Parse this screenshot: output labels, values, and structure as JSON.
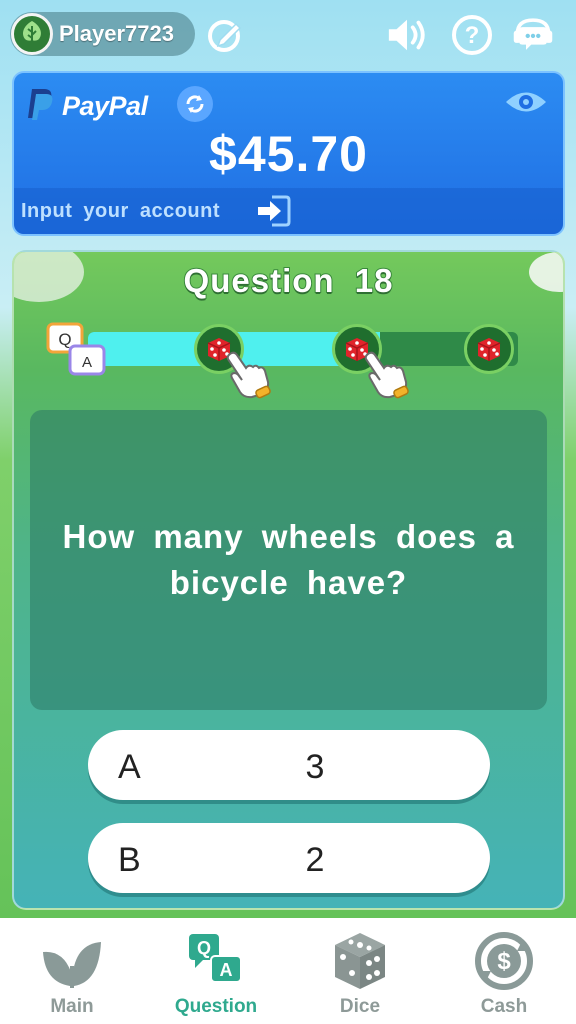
{
  "header": {
    "player_name": "Player7723",
    "icons": [
      "tree-avatar-icon",
      "edit-icon",
      "sound-icon",
      "help-icon",
      "support-chat-icon"
    ]
  },
  "paypal": {
    "brand": "PayPal",
    "balance": "$45.70",
    "account_prompt": "Input your account",
    "icons": [
      "paypal-icon",
      "refresh-icon",
      "eye-icon",
      "login-icon"
    ]
  },
  "quiz": {
    "title": "Question 18",
    "progress": 0.68,
    "question": "How many wheels does a bicycle have?",
    "answers": [
      {
        "letter": "A",
        "value": "3"
      },
      {
        "letter": "B",
        "value": "2"
      }
    ]
  },
  "nav": {
    "items": [
      {
        "label": "Main",
        "icon": "leaf-icon",
        "active": false
      },
      {
        "label": "Question",
        "icon": "qa-icon",
        "active": true
      },
      {
        "label": "Dice",
        "icon": "dice-icon",
        "active": false
      },
      {
        "label": "Cash",
        "icon": "cash-icon",
        "active": false
      }
    ]
  },
  "colors": {
    "paypal_blue": "#1f6ee3",
    "active_tab": "#2fa98e",
    "inactive_tab": "#8e9a98",
    "progress_fill": "#4ff0ee"
  }
}
